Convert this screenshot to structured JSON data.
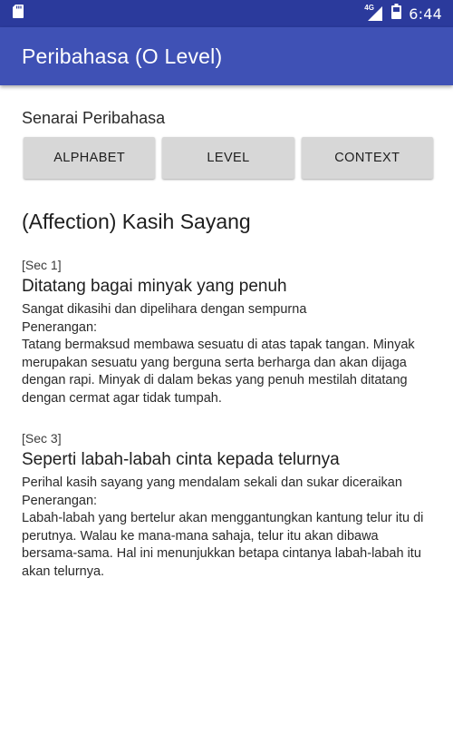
{
  "status_bar": {
    "network_label": "4G",
    "time": "6:44"
  },
  "app_bar": {
    "title": "Peribahasa (O Level)"
  },
  "list_section": {
    "label": "Senarai Peribahasa",
    "buttons": [
      "ALPHABET",
      "LEVEL",
      "CONTEXT"
    ]
  },
  "category": {
    "title": "(Affection) Kasih Sayang"
  },
  "entries": [
    {
      "sec": "[Sec 1]",
      "proverb": "Ditatang bagai minyak yang penuh",
      "meaning": "Sangat dikasihi dan dipelihara dengan sempurna",
      "explanation_label": "Penerangan:",
      "explanation": "Tatang bermaksud membawa sesuatu di atas tapak tangan. Minyak merupakan sesuatu yang berguna serta berharga dan akan dijaga dengan rapi. Minyak di dalam bekas yang penuh mestilah ditatang dengan cermat agar tidak tumpah."
    },
    {
      "sec": "[Sec 3]",
      "proverb": "Seperti labah-labah cinta kepada telurnya",
      "meaning": "Perihal kasih sayang yang mendalam sekali dan sukar diceraikan",
      "explanation_label": "Penerangan:",
      "explanation": "Labah-labah yang bertelur akan menggantungkan kantung telur itu di perutnya. Walau ke mana-mana sahaja, telur itu akan dibawa bersama-sama. Hal ini menunjukkan betapa cintanya labah-labah itu akan telurnya."
    }
  ],
  "colors": {
    "status_bar": "#2b3a9c",
    "app_bar": "#3f51b5",
    "button_bg": "#d7d7d7"
  },
  "icons": [
    "sd-card-icon",
    "signal-icon",
    "battery-icon"
  ]
}
